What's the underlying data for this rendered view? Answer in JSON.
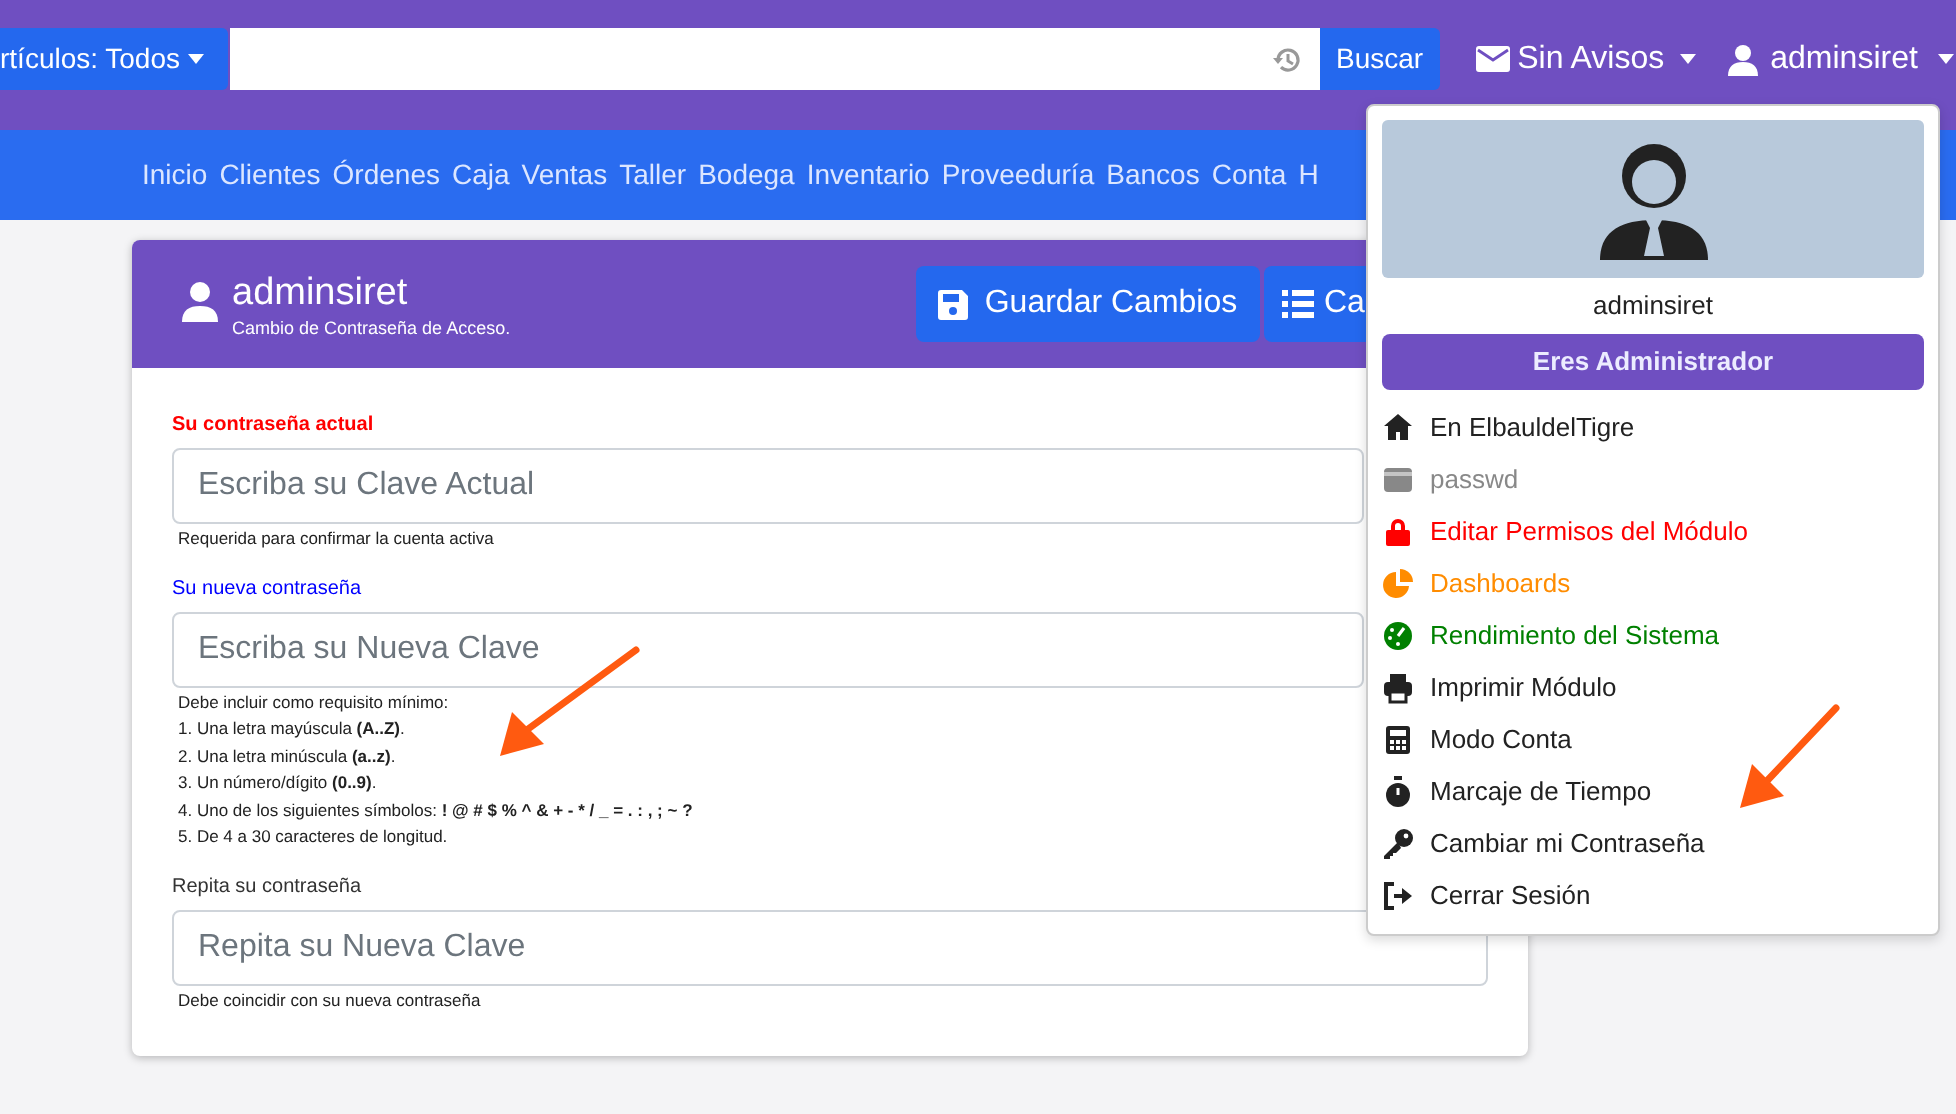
{
  "topbar": {
    "filter_button": "rtículos: Todos",
    "search_button": "Buscar",
    "notifications": "Sin Avisos",
    "user": "adminsiret"
  },
  "nav": {
    "items": [
      "Inicio",
      "Clientes",
      "Órdenes",
      "Caja",
      "Ventas",
      "Taller",
      "Bodega",
      "Inventario",
      "Proveeduría",
      "Bancos",
      "Conta",
      "H"
    ]
  },
  "card": {
    "title": "adminsiret",
    "subtitle": "Cambio de Contraseña de Acceso.",
    "buttons": [
      {
        "label": "Guardar Cambios"
      },
      {
        "label": "Ca"
      }
    ],
    "fields": [
      {
        "label": "Su contraseña actual",
        "kind": "required",
        "placeholder": "Escriba su Clave Actual",
        "help": [
          "Requerida para confirmar la cuenta activa"
        ]
      },
      {
        "label": "Su nueva contraseña",
        "kind": "new",
        "placeholder": "Escriba su Nueva Clave",
        "help": [
          "Debe incluir como requisito mínimo:",
          "1. Una letra mayúscula **(A..Z)**.",
          "2. Una letra minúscula **(a..z)**.",
          "3. Un número/dígito **(0..9)**.",
          "4. Uno de los siguientes símbolos: **! @ # $ % ^ & + - * / _ = . : , ; ~ ?**",
          "5. De 4 a 30 caracteres de longitud."
        ]
      },
      {
        "label": "Repita su contraseña",
        "kind": "plain",
        "placeholder": "Repita su Nueva Clave",
        "help": [
          "Debe coincidir con su nueva contraseña"
        ]
      }
    ]
  },
  "user_menu": {
    "name": "adminsiret",
    "role_button": "Eres Administrador",
    "items": [
      {
        "label": "En ElbauldelTigre",
        "color": "#222222"
      },
      {
        "label": "passwd",
        "color": "#888888"
      },
      {
        "label": "Editar Permisos del Módulo",
        "color": "#ff0000"
      },
      {
        "label": "Dashboards",
        "color": "#ff8c00"
      },
      {
        "label": "Rendimiento del Sistema",
        "color": "#008000"
      },
      {
        "label": "Imprimir Módulo",
        "color": "#222222"
      },
      {
        "label": "Modo Conta",
        "color": "#222222"
      },
      {
        "label": "Marcaje de Tiempo",
        "color": "#222222"
      },
      {
        "label": "Cambiar mi Contraseña",
        "color": "#222222"
      },
      {
        "label": "Cerrar Sesión",
        "color": "#222222"
      }
    ]
  }
}
